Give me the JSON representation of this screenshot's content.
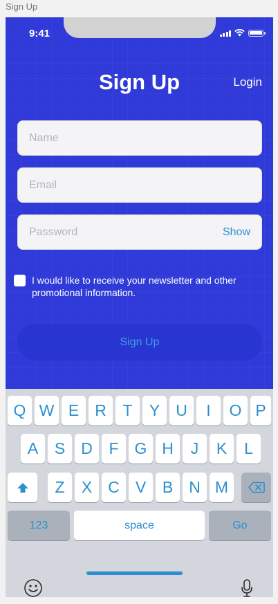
{
  "frame_label": "Sign Up",
  "status": {
    "time": "9:41"
  },
  "header": {
    "title": "Sign Up",
    "login_label": "Login"
  },
  "form": {
    "name_placeholder": "Name",
    "email_placeholder": "Email",
    "password_placeholder": "Password",
    "show_label": "Show",
    "newsletter_text": "I would like to receive your newsletter and other promotional information.",
    "newsletter_checked": false,
    "submit_label": "Sign Up"
  },
  "keyboard": {
    "row1": [
      "Q",
      "W",
      "E",
      "R",
      "T",
      "Y",
      "U",
      "I",
      "O",
      "P"
    ],
    "row2": [
      "A",
      "S",
      "D",
      "F",
      "G",
      "H",
      "J",
      "K",
      "L"
    ],
    "row3": [
      "Z",
      "X",
      "C",
      "V",
      "B",
      "N",
      "M"
    ],
    "numbers_label": "123",
    "space_label": "space",
    "go_label": "Go",
    "shift_icon": "shift-icon",
    "delete_icon": "backspace-icon",
    "emoji_icon": "emoji-icon",
    "mic_icon": "microphone-icon"
  },
  "colors": {
    "background": "#2f3ad8",
    "button": "#2935d0",
    "accent": "#2d8fd0"
  }
}
